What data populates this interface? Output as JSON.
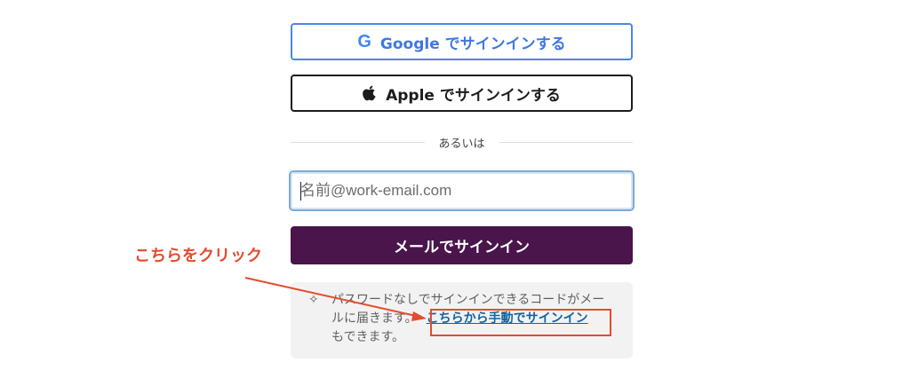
{
  "signin": {
    "google_label": "Google でサインインする",
    "apple_label": "Apple でサインインする",
    "divider_text": "あるいは",
    "email_placeholder": "名前@work-email.com",
    "email_value": "",
    "submit_label": "メールでサインイン"
  },
  "note": {
    "text": "パスワードなしでサインインできるコードがメールに届きます。",
    "link": "こちらから手動でサインイン",
    "suffix": "もできます。"
  },
  "annotation": {
    "label": "こちらをクリック",
    "color": "#e34c2e"
  },
  "icons": {
    "google": "google-logo-icon",
    "apple": "apple-logo-icon",
    "sparkle": "sparkle-icon"
  },
  "colors": {
    "brand_purple": "#4a154b",
    "google_blue": "#3f78e0",
    "link_blue": "#1264a3"
  }
}
